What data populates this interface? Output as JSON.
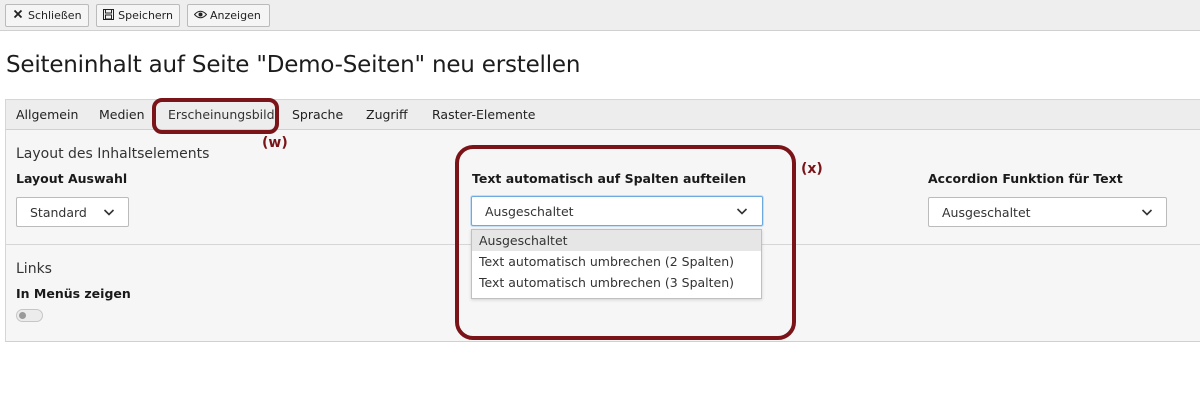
{
  "toolbar": {
    "close": {
      "label": "Schließen",
      "icon": "close-icon"
    },
    "save": {
      "label": "Speichern",
      "icon": "save-icon"
    },
    "view": {
      "label": "Anzeigen",
      "icon": "eye-icon"
    }
  },
  "page_title": "Seiteninhalt auf Seite \"Demo-Seiten\" neu erstellen",
  "tabs": [
    {
      "label": "Allgemein"
    },
    {
      "label": "Medien"
    },
    {
      "label": "Erscheinungsbild",
      "active": true
    },
    {
      "label": "Sprache"
    },
    {
      "label": "Zugriff"
    },
    {
      "label": "Raster-Elemente"
    }
  ],
  "layout_section": {
    "title": "Layout des Inhaltselements",
    "layout_select": {
      "label": "Layout Auswahl",
      "value": "Standard"
    },
    "columns_select": {
      "label": "Text automatisch auf Spalten aufteilen",
      "value": "Ausgeschaltet",
      "options": [
        "Ausgeschaltet",
        "Text automatisch umbrechen (2 Spalten)",
        "Text automatisch umbrechen (3 Spalten)"
      ]
    },
    "accordion_select": {
      "label": "Accordion Funktion für Text",
      "value": "Ausgeschaltet"
    }
  },
  "links_section": {
    "title": "Links",
    "menu_toggle": {
      "label": "In Menüs zeigen",
      "checked": false
    }
  },
  "annotations": {
    "w": "(w)",
    "x": "(x)",
    "color": "#7a1418"
  }
}
